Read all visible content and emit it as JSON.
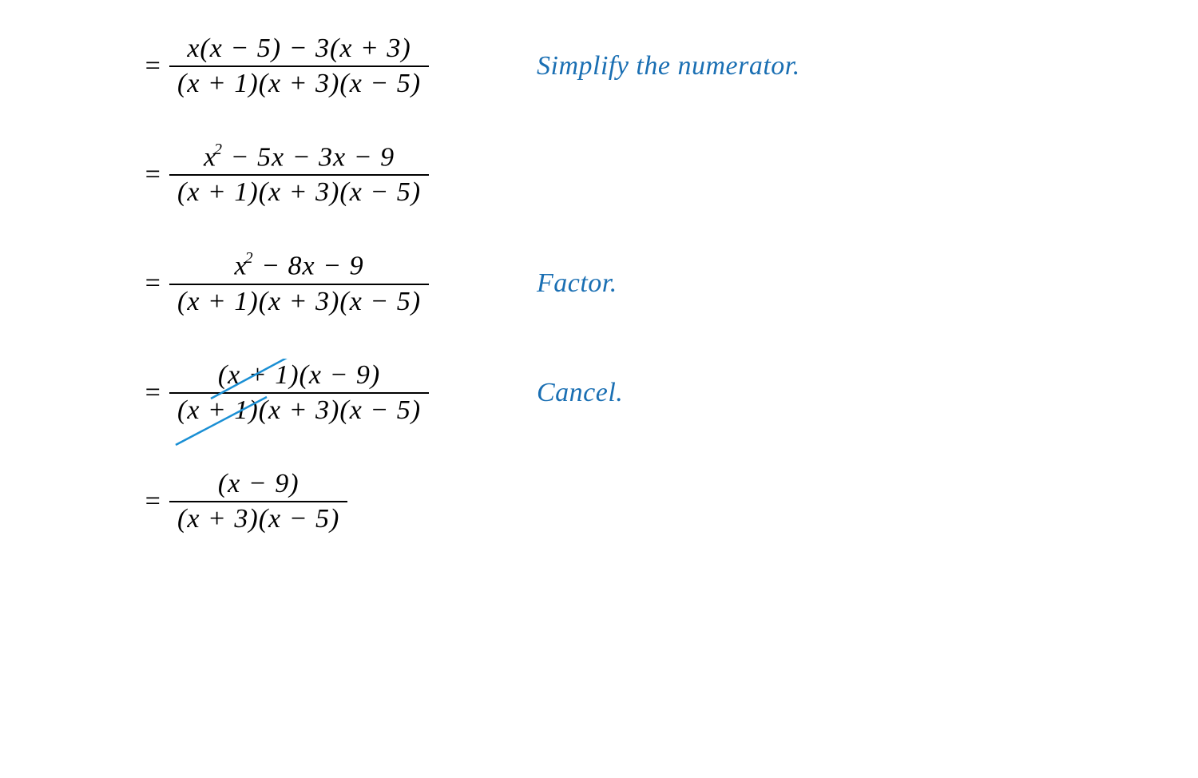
{
  "equals": "=",
  "steps": [
    {
      "num_html": "<span class='mi'>x</span>(<span class='mi'>x</span> − 5) − 3(<span class='mi'>x</span> + 3)",
      "den_html": "(<span class='mi'>x</span> + 1)(<span class='mi'>x</span> + 3)(<span class='mi'>x</span> − 5)",
      "annot": "Simplify the numerator."
    },
    {
      "num_html": "<span class='mi'>x</span><span class='sup'>2</span> − 5<span class='mi'>x</span> − 3<span class='mi'>x</span> − 9",
      "den_html": "(<span class='mi'>x</span> + 1)(<span class='mi'>x</span> + 3)(<span class='mi'>x</span> − 5)",
      "annot": ""
    },
    {
      "num_html": "<span class='mi'>x</span><span class='sup'>2</span> − 8<span class='mi'>x</span> − 9",
      "den_html": "(<span class='mi'>x</span> + 1)(<span class='mi'>x</span> + 3)(<span class='mi'>x</span> − 5)",
      "annot": "Factor."
    },
    {
      "num_html": "(<span class='mi'>x</span> + 1)(<span class='mi'>x</span> − 9)",
      "den_html": "(<span class='mi'>x</span> + 1)(<span class='mi'>x</span> + 3)(<span class='mi'>x</span> − 5)",
      "annot": "Cancel.",
      "cancel": true
    },
    {
      "num_html": "(<span class='mi'>x</span> − 9)",
      "den_html": "(<span class='mi'>x</span> + 3)(<span class='mi'>x</span> − 5)",
      "annot": ""
    }
  ]
}
